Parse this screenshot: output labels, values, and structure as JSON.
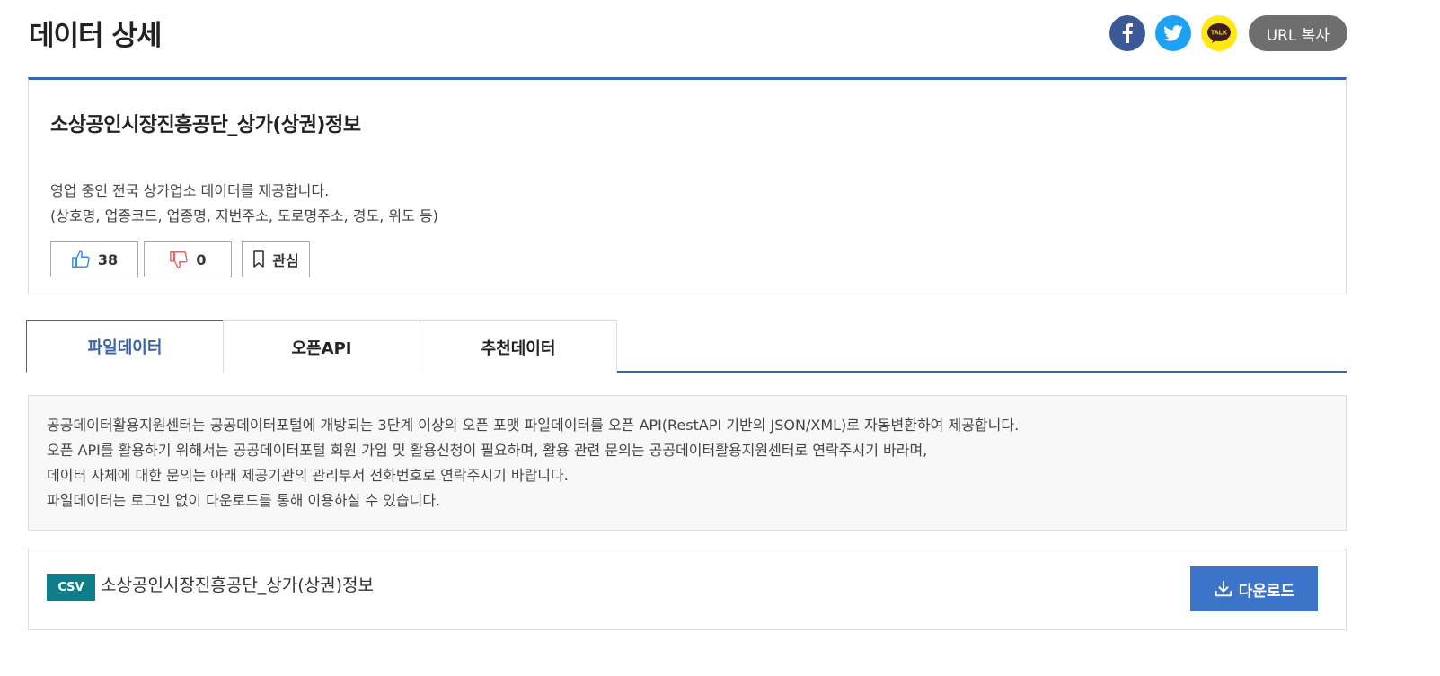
{
  "header": {
    "title": "데이터 상세",
    "share": {
      "kakao_text": "TALK",
      "url_copy_label": "URL 복사",
      "colors": {
        "facebook": "#3b5998",
        "twitter": "#1da1f2",
        "kakao": "#ffe812"
      }
    }
  },
  "dataset": {
    "title": "소상공인시장진흥공단_상가(상권)정보",
    "description": [
      "영업 중인 전국 상가업소 데이터를 제공합니다.",
      "(상호명, 업종코드, 업종명, 지번주소, 도로명주소, 경도, 위도 등)"
    ],
    "likes": "38",
    "dislikes": "0",
    "favorite_label": "관심"
  },
  "tabs": [
    {
      "label": "파일데이터",
      "active": true
    },
    {
      "label": "오픈API",
      "active": false
    },
    {
      "label": "추천데이터",
      "active": false
    }
  ],
  "notice": [
    "공공데이터활용지원센터는 공공데이터포털에 개방되는 3단계 이상의 오픈 포맷 파일데이터를 오픈 API(RestAPI 기반의 JSON/XML)로 자동변환하여 제공합니다.",
    "오픈 API를 활용하기 위해서는 공공데이터포털 회원 가입 및 활용신청이 필요하며, 활용 관련 문의는 공공데이터활용지원센터로 연락주시기 바라며,",
    "데이터 자체에 대한 문의는 아래 제공기관의 관리부서 전화번호로 연락주시기 바랍니다.",
    "파일데이터는 로그인 없이 다운로드를 통해 이용하실 수 있습니다."
  ],
  "file": {
    "format": "CSV",
    "name": "소상공인시장진흥공단_상가(상권)정보",
    "download_label": "다운로드"
  }
}
